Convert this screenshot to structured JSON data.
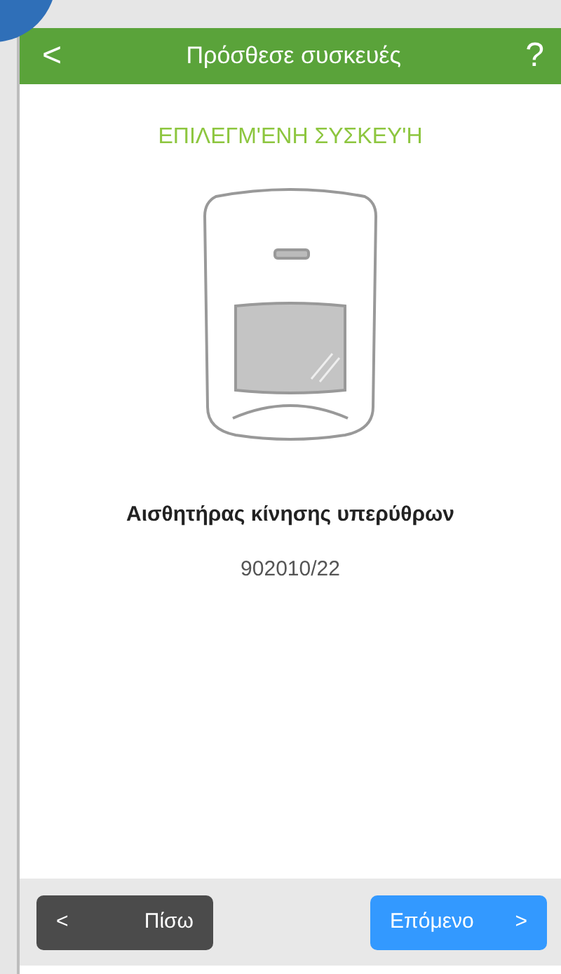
{
  "header": {
    "back_icon": "<",
    "title": "Πρόσθεσε συσκευές",
    "help": "?"
  },
  "section_title": "ΕΠΙΛΕΓΜ'ΕΝΗ ΣΥΣΚΕΥ'Η",
  "device": {
    "name": "Αισθητήρας κίνησης υπερύθρων",
    "code": "902010/22"
  },
  "footer": {
    "buttons": [
      {
        "kind": "back",
        "label": "Πίσω",
        "arrow": "<"
      },
      {
        "kind": "next",
        "label": "Επόμενο",
        "arrow": ">"
      }
    ]
  }
}
